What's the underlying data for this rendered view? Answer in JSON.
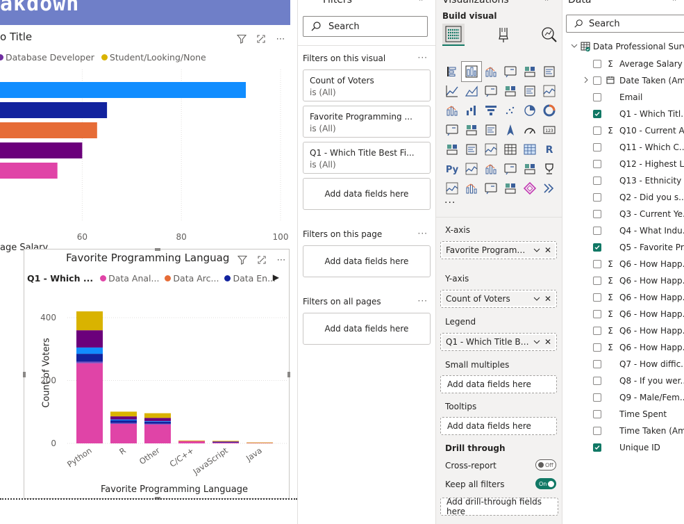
{
  "canvas": {
    "banner_text": "akdown",
    "visual1": {
      "title": "o Title",
      "legend": [
        {
          "label": "Database Developer",
          "color": "#6f2fa0"
        },
        {
          "label": "Student/Looking/None",
          "color": "#d9b300"
        }
      ],
      "x_ticks": [
        "60",
        "80",
        "100"
      ],
      "x_label": "age Salary"
    },
    "visual2": {
      "title": "Favorite Programming Languag",
      "legend_header": "Q1 - Which ...",
      "legend": [
        {
          "label": "Data Anal...",
          "color": "#e044a7"
        },
        {
          "label": "Data Arc...",
          "color": "#e66c37"
        },
        {
          "label": "Data En...",
          "color": "#12239e"
        }
      ],
      "y_label": "Count of Voters",
      "x_label": "Favorite Programming Language"
    }
  },
  "chart_data": [
    {
      "type": "bar",
      "orientation": "horizontal",
      "title": "o Title",
      "xlabel": "age Salary",
      "x_ticks": [
        60,
        80,
        100
      ],
      "xlim": [
        0,
        100
      ],
      "series": [
        {
          "color": "#118dff",
          "value": 93
        },
        {
          "color": "#12239e",
          "value": 65
        },
        {
          "color": "#e66c37",
          "value": 63
        },
        {
          "color": "#6b007b",
          "value": 60
        },
        {
          "color": "#e044a7",
          "value": 55
        }
      ]
    },
    {
      "type": "bar",
      "stacked": true,
      "title": "Favorite Programming Languag",
      "xlabel": "Favorite Programming Language",
      "ylabel": "Count of Voters",
      "ylim": [
        0,
        440
      ],
      "y_ticks": [
        0,
        200,
        400
      ],
      "categories": [
        "Python",
        "R",
        "Other",
        "C/C++",
        "JavaScript",
        "Java"
      ],
      "series": [
        {
          "name": "Data Anal...",
          "color": "#e044a7",
          "values": [
            255,
            62,
            60,
            8,
            3,
            2
          ]
        },
        {
          "color": "#744ec2",
          "values": [
            5,
            3,
            3,
            0,
            1,
            0
          ]
        },
        {
          "name": "Data En...",
          "color": "#12239e",
          "values": [
            25,
            8,
            6,
            0,
            1,
            0
          ]
        },
        {
          "color": "#118dff",
          "values": [
            20,
            3,
            2,
            0,
            0,
            0
          ]
        },
        {
          "color": "#6b007b",
          "values": [
            55,
            10,
            10,
            0,
            1,
            0
          ]
        },
        {
          "color": "#d9b300",
          "values": [
            60,
            15,
            15,
            1,
            2,
            1
          ]
        }
      ]
    }
  ],
  "filters": {
    "header": "Filters",
    "collapse": "»",
    "search_placeholder": "Search",
    "on_visual_label": "Filters on this visual",
    "more": "···",
    "cards": [
      {
        "title": "Count of Voters",
        "sub": "is (All)"
      },
      {
        "title": "Favorite Programming ...",
        "sub": "is (All)"
      },
      {
        "title": "Q1 - Which Title Best Fi...",
        "sub": "is (All)"
      }
    ],
    "add_fields": "Add data fields here",
    "on_page_label": "Filters on this page",
    "on_all_label": "Filters on all pages"
  },
  "viz": {
    "header": "Visualizations",
    "collapse": "»",
    "build_label": "Build visual",
    "more": "···",
    "wells": {
      "xaxis_label": "X-axis",
      "xaxis_value": "Favorite Programmin...",
      "yaxis_label": "Y-axis",
      "yaxis_value": "Count of Voters",
      "legend_label": "Legend",
      "legend_value": "Q1 - Which Title Best ...",
      "small_multiples_label": "Small multiples",
      "small_multiples_value": "Add data fields here",
      "tooltips_label": "Tooltips",
      "tooltips_value": "Add data fields here",
      "drill_label": "Drill through",
      "cross_report_label": "Cross-report",
      "cross_report_state": "Off",
      "keep_filters_label": "Keep all filters",
      "keep_filters_state": "On",
      "drill_add": "Add drill-through fields here"
    },
    "accent": "#117865"
  },
  "data_pane": {
    "header": "Data",
    "collapse": "»",
    "search_placeholder": "Search",
    "table_name": "Data Professional Surv...",
    "fields": [
      {
        "name": "Average Salary",
        "sigma": true,
        "checked": false,
        "expandable": false,
        "icon": ""
      },
      {
        "name": "Date Taken (Am...",
        "sigma": false,
        "checked": false,
        "expandable": true,
        "icon": "calendar-icon"
      },
      {
        "name": "Email",
        "sigma": false,
        "checked": false,
        "expandable": false,
        "icon": ""
      },
      {
        "name": "Q1 - Which Titl...",
        "sigma": false,
        "checked": true,
        "expandable": false,
        "icon": ""
      },
      {
        "name": "Q10 - Current A...",
        "sigma": true,
        "checked": false,
        "expandable": false,
        "icon": ""
      },
      {
        "name": "Q11 - Which C...",
        "sigma": false,
        "checked": false,
        "expandable": false,
        "icon": ""
      },
      {
        "name": "Q12 - Highest L...",
        "sigma": false,
        "checked": false,
        "expandable": false,
        "icon": ""
      },
      {
        "name": "Q13 - Ethnicity",
        "sigma": false,
        "checked": false,
        "expandable": false,
        "icon": ""
      },
      {
        "name": "Q2 - Did you s...",
        "sigma": false,
        "checked": false,
        "expandable": false,
        "icon": ""
      },
      {
        "name": "Q3 - Current Ye...",
        "sigma": false,
        "checked": false,
        "expandable": false,
        "icon": ""
      },
      {
        "name": "Q4 - What Indu...",
        "sigma": false,
        "checked": false,
        "expandable": false,
        "icon": ""
      },
      {
        "name": "Q5 - Favorite Pr...",
        "sigma": false,
        "checked": true,
        "expandable": false,
        "icon": ""
      },
      {
        "name": "Q6 - How Happ...",
        "sigma": true,
        "checked": false,
        "expandable": false,
        "icon": ""
      },
      {
        "name": "Q6 - How Happ...",
        "sigma": true,
        "checked": false,
        "expandable": false,
        "icon": ""
      },
      {
        "name": "Q6 - How Happ...",
        "sigma": true,
        "checked": false,
        "expandable": false,
        "icon": ""
      },
      {
        "name": "Q6 - How Happ...",
        "sigma": true,
        "checked": false,
        "expandable": false,
        "icon": ""
      },
      {
        "name": "Q6 - How Happ...",
        "sigma": true,
        "checked": false,
        "expandable": false,
        "icon": ""
      },
      {
        "name": "Q6 - How Happ...",
        "sigma": true,
        "checked": false,
        "expandable": false,
        "icon": ""
      },
      {
        "name": "Q7 - How diffic...",
        "sigma": false,
        "checked": false,
        "expandable": false,
        "icon": ""
      },
      {
        "name": "Q8 - If you wer...",
        "sigma": false,
        "checked": false,
        "expandable": false,
        "icon": ""
      },
      {
        "name": "Q9 - Male/Fem...",
        "sigma": false,
        "checked": false,
        "expandable": false,
        "icon": ""
      },
      {
        "name": "Time Spent",
        "sigma": false,
        "checked": false,
        "expandable": false,
        "icon": ""
      },
      {
        "name": "Time Taken (Am...",
        "sigma": false,
        "checked": false,
        "expandable": false,
        "icon": ""
      },
      {
        "name": "Unique ID",
        "sigma": false,
        "checked": true,
        "expandable": false,
        "icon": ""
      }
    ]
  }
}
